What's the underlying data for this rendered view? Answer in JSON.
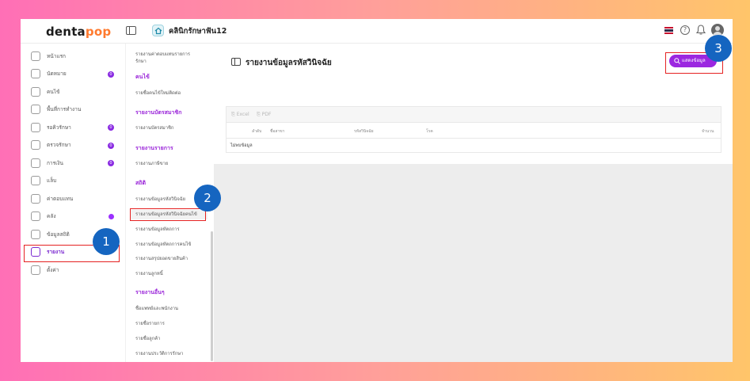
{
  "app": {
    "logo_main": "denta",
    "logo_accent": "pop",
    "clinic_name": "คลินิกรักษาฟัน12"
  },
  "sidebar": {
    "items": [
      {
        "label": "หน้าแรก",
        "icon": "home-icon"
      },
      {
        "label": "นัดหมาย",
        "icon": "calendar-icon",
        "badge": "0"
      },
      {
        "label": "คนไข้",
        "icon": "user-icon"
      },
      {
        "label": "พื้นที่การทำงาน",
        "icon": "workspace-icon"
      },
      {
        "label": "รอคิวรักษา",
        "icon": "queue-icon",
        "badge": "0"
      },
      {
        "label": "ตรวจรักษา",
        "icon": "scan-icon",
        "badge": "0"
      },
      {
        "label": "การเงิน",
        "icon": "money-icon",
        "badge": "0"
      },
      {
        "label": "แล็บ",
        "icon": "tooth-icon"
      },
      {
        "label": "ค่าตอบแทน",
        "icon": "percent-icon"
      },
      {
        "label": "คลัง",
        "icon": "box-icon",
        "dot": true
      },
      {
        "label": "ข้อมูลสถิติ",
        "icon": "chart-circle-icon"
      },
      {
        "label": "รายงาน",
        "icon": "report-icon",
        "active": true
      },
      {
        "label": "ตั้งค่า",
        "icon": "gear-icon"
      }
    ]
  },
  "submenu": {
    "items": [
      {
        "text": "รายงานค่าตอบแทนรายการ",
        "kind": "item"
      },
      {
        "text": "รักษา",
        "kind": "item"
      },
      {
        "text": "คนไข้",
        "kind": "head"
      },
      {
        "text": "รายชื่อคนไข้ใหม่ติดต่อ",
        "kind": "item"
      },
      {
        "text": "รายงานบัตรสมาชิก",
        "kind": "head"
      },
      {
        "text": "รายงานบัตรสมาชิก",
        "kind": "item"
      },
      {
        "text": "รายงานรายการ",
        "kind": "head"
      },
      {
        "text": "รายงานภาษีขาย",
        "kind": "item"
      },
      {
        "text": "สถิติ",
        "kind": "head"
      },
      {
        "text": "รายงานข้อมูลรหัสวินิจฉัย",
        "kind": "item"
      },
      {
        "text": "รายงานข้อมูลรหัสวินิจฉัยคนไข้",
        "kind": "item",
        "selected": true
      },
      {
        "text": "รายงานข้อมูลหัตถการ",
        "kind": "item"
      },
      {
        "text": "รายงานข้อมูลหัตถการคนไข้",
        "kind": "item"
      },
      {
        "text": "รายงานสรุปยอดขายสินค้า",
        "kind": "item"
      },
      {
        "text": "รายงานลูกหนี้",
        "kind": "item"
      },
      {
        "text": "รายงานอื่นๆ",
        "kind": "head"
      },
      {
        "text": "ชื่อแพทย์และพนักงาน",
        "kind": "item"
      },
      {
        "text": "รายชื่อรายการ",
        "kind": "item"
      },
      {
        "text": "รายชื่อลูกค้า",
        "kind": "item"
      },
      {
        "text": "รายงานประวัติการรักษา",
        "kind": "item"
      }
    ]
  },
  "main": {
    "title": "รายงานข้อมูลรหัสวินิจฉัย",
    "show_button": "แสดงข้อมูล",
    "toolbar": {
      "excel": "Excel",
      "pdf": "PDF"
    },
    "columns": [
      "ลำดับ",
      "ชื่อสาขา",
      "รหัสวินิจฉัย",
      "โรค",
      "จำนวน"
    ],
    "empty_text": "ไม่พบข้อมูล"
  },
  "annotations": [
    "1",
    "2",
    "3"
  ],
  "colors": {
    "accent": "#9b27e0",
    "marker": "#e52222",
    "step_badge": "#1565c0"
  }
}
